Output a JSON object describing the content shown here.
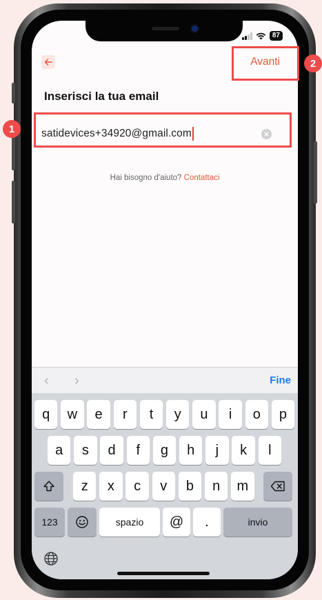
{
  "status_bar": {
    "battery": "87"
  },
  "header": {
    "next_label": "Avanti"
  },
  "main": {
    "title": "Inserisci la tua email",
    "email_value": "satidevices+34920@gmail.com",
    "help_text": "Hai bisogno d'aiuto? ",
    "help_link": "Contattaci"
  },
  "keyboard": {
    "done_label": "Fine",
    "row1": [
      "q",
      "w",
      "e",
      "r",
      "t",
      "y",
      "u",
      "i",
      "o",
      "p"
    ],
    "row2": [
      "a",
      "s",
      "d",
      "f",
      "g",
      "h",
      "j",
      "k",
      "l"
    ],
    "row3": [
      "z",
      "x",
      "c",
      "v",
      "b",
      "n",
      "m"
    ],
    "numbers_label": "123",
    "space_label": "spazio",
    "at_label": "@",
    "dot_label": ".",
    "return_label": "invio"
  },
  "callouts": {
    "one": "1",
    "two": "2"
  },
  "colors": {
    "accent": "#e05a3a",
    "callout": "#ee4b4b",
    "done_blue": "#1d7bf2"
  }
}
